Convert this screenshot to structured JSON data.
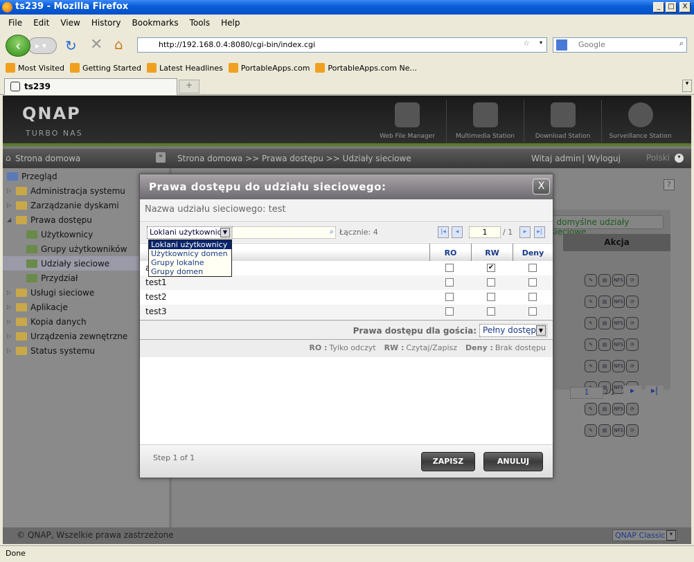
{
  "window": {
    "title": "ts239 - Mozilla Firefox",
    "min": "_",
    "max": "□",
    "close": "X"
  },
  "menu": [
    "File",
    "Edit",
    "View",
    "History",
    "Bookmarks",
    "Tools",
    "Help"
  ],
  "nav": {
    "url": "http://192.168.0.4:8080/cgi-bin/index.cgi",
    "search_placeholder": "Google"
  },
  "bookmarks": [
    "Most Visited",
    "Getting Started",
    "Latest Headlines",
    "PortableApps.com",
    "PortableApps.com Ne..."
  ],
  "tabs": [
    {
      "label": "ts239"
    }
  ],
  "app": {
    "logo": "QNAP",
    "tagline": "TURBO NAS",
    "stations": [
      "Web File Manager",
      "Multimedia Station",
      "Download Station",
      "Surveillance Station"
    ],
    "sidebar_title": "Strona domowa",
    "breadcrumb": "Strona domowa >> Prawa dostępu >> Udziały sieciowe",
    "welcome": "Witaj admin",
    "logout": "Wyloguj",
    "language": "Polski",
    "sidebar": [
      {
        "label": "Przegląd",
        "level": 0
      },
      {
        "label": "Administracja systemu",
        "level": 0
      },
      {
        "label": "Zarządzanie dyskami",
        "level": 0
      },
      {
        "label": "Prawa dostępu",
        "level": 0
      },
      {
        "label": "Użytkownicy",
        "level": 1
      },
      {
        "label": "Grupy użytkowników",
        "level": 1
      },
      {
        "label": "Udziały sieciowe",
        "level": 1,
        "selected": true
      },
      {
        "label": "Przydział",
        "level": 1
      },
      {
        "label": "Usługi sieciowe",
        "level": 0
      },
      {
        "label": "Aplikacje",
        "level": 0
      },
      {
        "label": "Kopia danych",
        "level": 0
      },
      {
        "label": "Urządzenia zewnętrzne",
        "level": 0
      },
      {
        "label": "Status systemu",
        "level": 0
      }
    ],
    "restore_button": "t domyślne udziały sieciowe",
    "actions_header": "Akcja",
    "bg_page": "1",
    "bg_page_of": "/ 1",
    "copyright": "© QNAP, Wszelkie prawa zastrzeżone",
    "theme": "QNAP Classic"
  },
  "dialog": {
    "title": "Prawa dostępu do udziału sieciowego:",
    "close": "X",
    "share_name": "Nazwa udziału sieciowego: test",
    "type_selected": "Loklani użytkownicy",
    "type_options": [
      "Loklani użytkownicy",
      "Użytkownicy domen",
      "Grupy lokalne",
      "Grupy domen"
    ],
    "total": "Łącznie:  4",
    "page": "1",
    "page_of": "/ 1",
    "columns": [
      "RO",
      "RW",
      "Deny"
    ],
    "rows": [
      {
        "name": "admin",
        "ro": false,
        "rw": true,
        "deny": false
      },
      {
        "name": "test1",
        "ro": false,
        "rw": false,
        "deny": false
      },
      {
        "name": "test2",
        "ro": false,
        "rw": false,
        "deny": false
      },
      {
        "name": "test3",
        "ro": false,
        "rw": false,
        "deny": false
      }
    ],
    "guest_label": "Prawa dostępu dla gościa:",
    "guest_value": "Pełny dostęp",
    "legend": [
      {
        "k": "RO :",
        "v": "Tylko odczyt"
      },
      {
        "k": "RW :",
        "v": "Czytaj/Zapisz"
      },
      {
        "k": "Deny :",
        "v": "Brak dostępu"
      }
    ],
    "step": "Step 1 of 1",
    "save": "ZAPISZ",
    "cancel": "ANULUJ"
  },
  "status": "Done"
}
